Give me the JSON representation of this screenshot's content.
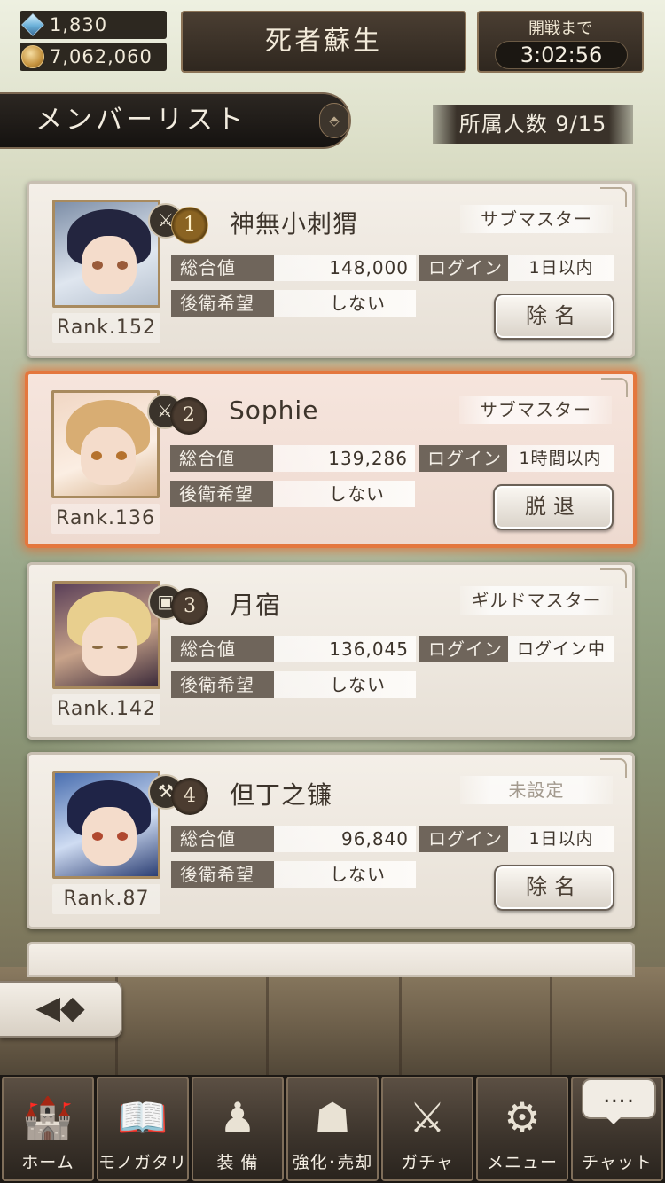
{
  "currency": {
    "gems": "1,830",
    "gold": "7,062,060"
  },
  "header": {
    "title": "死者蘇生",
    "timer_label": "開戦まで",
    "timer_value": "3:02:56"
  },
  "list": {
    "title": "メンバーリスト",
    "sort_icon": "sort-icon",
    "member_count": "所属人数 9/15"
  },
  "labels": {
    "total": "総合値",
    "login": "ログイン",
    "rear_guard": "後衛希望"
  },
  "members": [
    {
      "num": "1",
      "name": "神無小刺猬",
      "role": "サブマスター",
      "total": "148,000",
      "login": "1日以内",
      "rear": "しない",
      "rank": "Rank.152",
      "class_icon": "sword-icon",
      "class_glyph": "⚔",
      "action": "除名"
    },
    {
      "num": "2",
      "name": "Sophie",
      "role": "サブマスター",
      "total": "139,286",
      "login": "1時間以内",
      "rear": "しない",
      "rank": "Rank.136",
      "class_icon": "sword-icon",
      "class_glyph": "⚔",
      "action": "脱退"
    },
    {
      "num": "3",
      "name": "月宿",
      "role": "ギルドマスター",
      "total": "136,045",
      "login": "ログイン中",
      "rear": "しない",
      "rank": "Rank.142",
      "class_icon": "book-icon",
      "class_glyph": "▣",
      "action": ""
    },
    {
      "num": "4",
      "name": "但丁之镰",
      "role": "未設定",
      "total": "96,840",
      "login": "1日以内",
      "rear": "しない",
      "rank": "Rank.87",
      "class_icon": "hammer-icon",
      "class_glyph": "⚒",
      "action": "除名"
    }
  ],
  "nav": {
    "back_glyph": "◀◆",
    "items": [
      {
        "label": "ホーム",
        "icon": "castle-icon",
        "glyph": "🏰"
      },
      {
        "label": "モノガタリ",
        "icon": "book-icon",
        "glyph": "📖"
      },
      {
        "label": "装 備",
        "icon": "puppet-icon",
        "glyph": "♟"
      },
      {
        "label": "強化･売却",
        "icon": "mask-icon",
        "glyph": "☗"
      },
      {
        "label": "ガチャ",
        "icon": "crossed-swords-icon",
        "glyph": "⚔"
      },
      {
        "label": "メニュー",
        "icon": "gear-icon",
        "glyph": "⚙"
      },
      {
        "label": "チャット",
        "icon": "chat-icon",
        "glyph": ""
      }
    ],
    "chat_bubble": "…."
  }
}
